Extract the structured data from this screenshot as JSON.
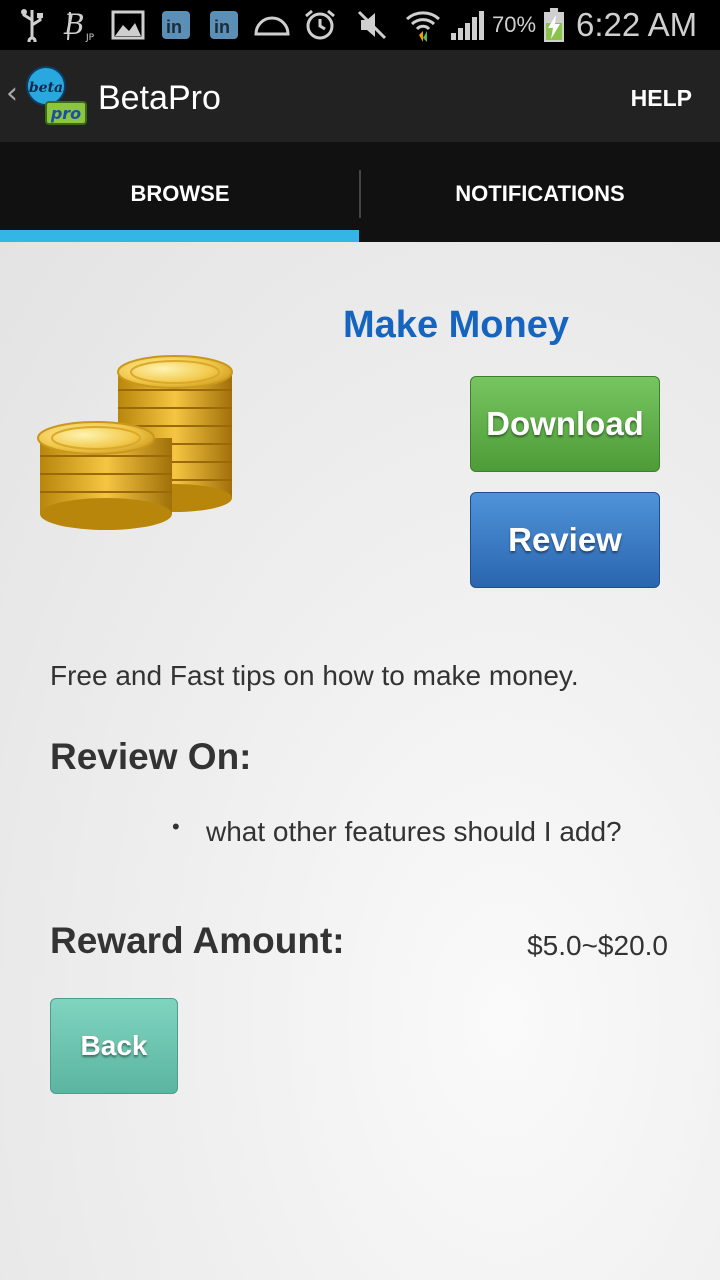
{
  "status_bar": {
    "battery": "70%",
    "time": "6:22 AM",
    "icons": [
      "usb-icon",
      "b-jp-icon",
      "image-icon",
      "linkedin-icon",
      "linkedin-icon",
      "half-circle-icon",
      "alarm-icon",
      "mute-icon",
      "wifi-icon",
      "signal-icon",
      "battery-charging-icon"
    ]
  },
  "action_bar": {
    "title": "BetaPro",
    "help": "HELP",
    "logo_top": "beta",
    "logo_bottom": "pro"
  },
  "tabs": [
    {
      "label": "BROWSE",
      "selected": true
    },
    {
      "label": "NOTIFICATIONS",
      "selected": false
    }
  ],
  "app": {
    "title": "Make Money",
    "download_label": "Download",
    "review_label": "Review",
    "description": "Free and Fast tips on how to make money.",
    "review_heading": "Review On:",
    "review_items": [
      "what other features should I add?"
    ],
    "reward_label": "Reward Amount:",
    "reward_value": "$5.0~$20.0",
    "back_label": "Back"
  },
  "colors": {
    "accent_tab": "#33b5e5",
    "title_blue": "#1565c0",
    "download_green": "#5aa943",
    "review_blue": "#3a7bc8",
    "back_teal": "#6cc5b0"
  }
}
